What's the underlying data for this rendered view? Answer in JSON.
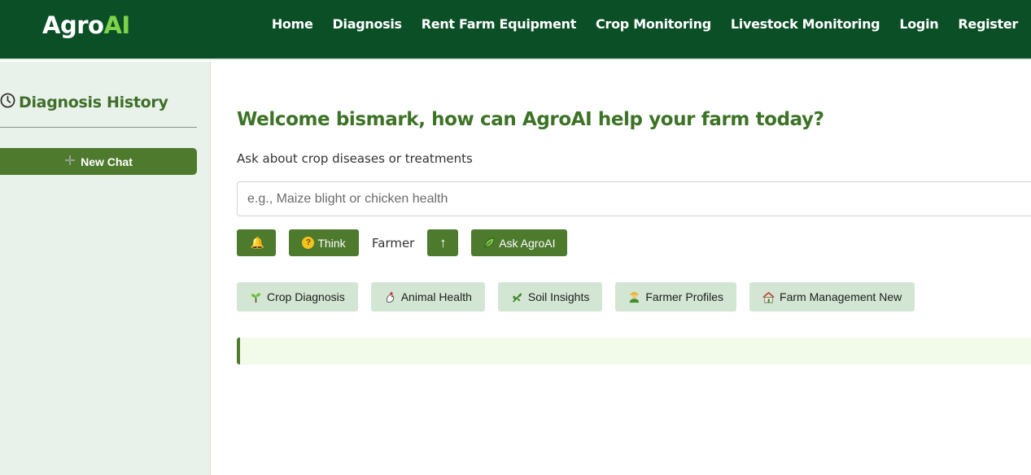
{
  "app": {
    "logo_main": "Agro",
    "logo_accent": "AI"
  },
  "nav": [
    {
      "label": "Home"
    },
    {
      "label": "Diagnosis"
    },
    {
      "label": "Rent Farm Equipment"
    },
    {
      "label": "Crop Monitoring"
    },
    {
      "label": "Livestock Monitoring"
    },
    {
      "label": "Login"
    },
    {
      "label": "Register"
    }
  ],
  "sidebar": {
    "title": "Diagnosis History",
    "title_icon": "clock-icon",
    "new_chat_label": "New Chat",
    "new_chat_icon": "plus-icon"
  },
  "main": {
    "welcome": "Welcome bismark, how can AgroAI help your farm today?",
    "ask_label": "Ask about crop diseases or treatments",
    "query_placeholder": "e.g., Maize blight or chicken health",
    "query_value": "",
    "controls": {
      "bell_icon": "bell-icon",
      "think_label": "Think",
      "role_label": "Farmer",
      "up_label": "↑",
      "ask_label": "Ask AgroAI"
    },
    "chips": [
      {
        "label": "Crop Diagnosis",
        "icon": "seedling-icon"
      },
      {
        "label": "Animal Health",
        "icon": "chicken-icon"
      },
      {
        "label": "Soil Insights",
        "icon": "herb-icon"
      },
      {
        "label": "Farmer Profiles",
        "icon": "farmer-icon"
      },
      {
        "label": "Farm Management New",
        "icon": "farmhouse-icon"
      }
    ],
    "response_text": ""
  },
  "colors": {
    "header_bg": "#0b4f27",
    "accent": "#4e7a2e",
    "logo_accent": "#7fd34b",
    "heading": "#3d7326",
    "sidebar_bg": "#e9f2ea",
    "chip_bg": "#d2e6d3",
    "response_bg": "#f2faea"
  }
}
